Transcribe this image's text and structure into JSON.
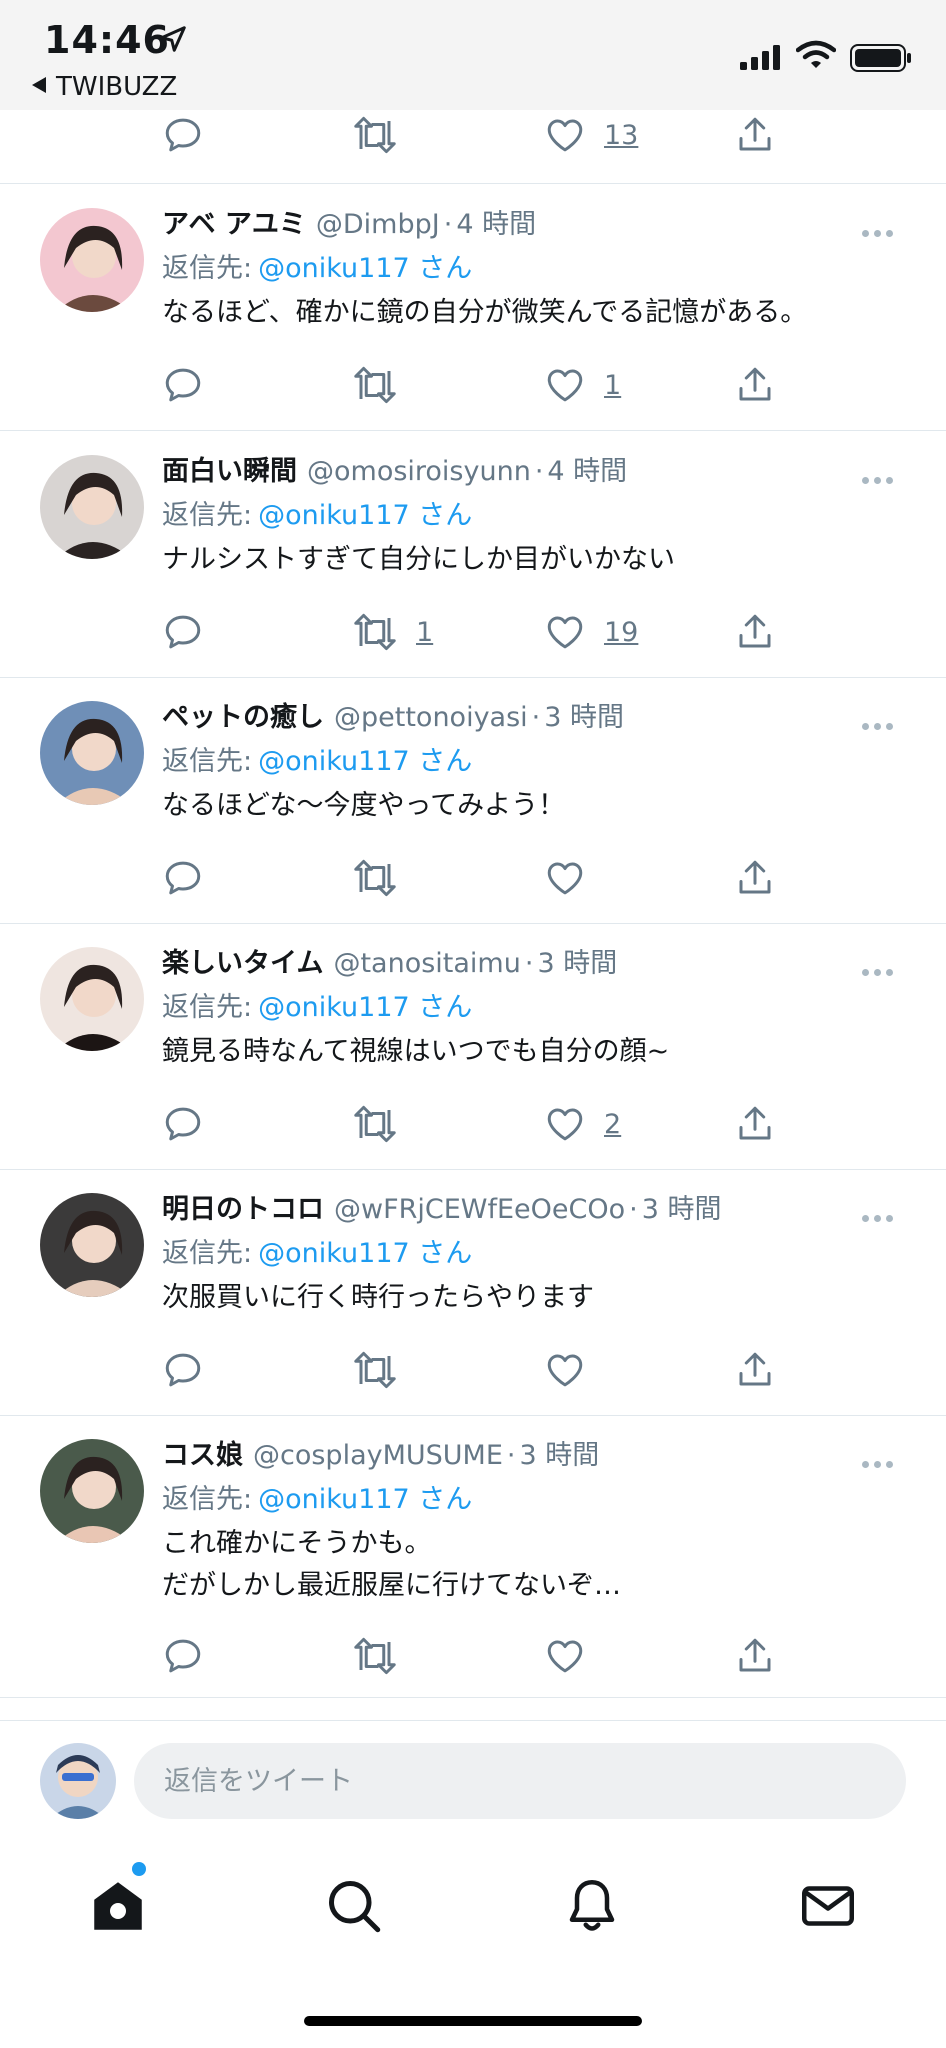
{
  "status_bar": {
    "time": "14:46",
    "back_label": "TWIBUZZ"
  },
  "top_partial": {
    "like_count": "13"
  },
  "reply_prefix": "返信先:",
  "tweets": [
    {
      "name": "アベ アユミ",
      "handle": "@DimbpJ",
      "time": "4 時間",
      "reply_to": "@oniku117 さん",
      "text": "なるほど、確かに鏡の自分が微笑んでる記憶がある。",
      "retweets": "",
      "likes": "1",
      "avatar_colors": [
        "#f3c7d0",
        "#6b4a3e"
      ]
    },
    {
      "name": "面白い瞬間",
      "handle": "@omosiroisyunn",
      "time": "4 時間",
      "reply_to": "@oniku117 さん",
      "text": "ナルシストすぎて自分にしか目がいかない",
      "retweets": "1",
      "likes": "19",
      "avatar_colors": [
        "#d8d4d2",
        "#2a2322"
      ]
    },
    {
      "name": "ペットの癒し",
      "handle": "@pettonoiyasi",
      "time": "3 時間",
      "reply_to": "@oniku117 さん",
      "text": "なるほどな〜今度やってみよう！",
      "retweets": "",
      "likes": "",
      "avatar_colors": [
        "#6f8fb7",
        "#e8c9b5"
      ]
    },
    {
      "name": "楽しいタイム",
      "handle": "@tanositaimu",
      "time": "3 時間",
      "reply_to": "@oniku117 さん",
      "text": "鏡見る時なんて視線はいつでも自分の顔~",
      "retweets": "",
      "likes": "2",
      "avatar_colors": [
        "#efe5e0",
        "#1c1514"
      ]
    },
    {
      "name": "明日のトコロ",
      "handle": "@wFRjCEWfEeOeCOo",
      "time": "3 時間",
      "reply_to": "@oniku117 さん",
      "text": "次服買いに行く時行ったらやります",
      "retweets": "",
      "likes": "",
      "avatar_colors": [
        "#3b3a3a",
        "#e6cdbd"
      ]
    },
    {
      "name": "コス娘",
      "handle": "@cosplayMUSUME",
      "time": "3 時間",
      "reply_to": "@oniku117 さん",
      "text": "これ確かにそうかも。\nだがしかし最近服屋に行けてないぞ…",
      "retweets": "",
      "likes": "",
      "avatar_colors": [
        "#4a5a4b",
        "#e9c6b4"
      ]
    }
  ],
  "reply_bar": {
    "placeholder": "返信をツイート"
  },
  "tab_bar": {
    "items": [
      "home-icon",
      "search-icon",
      "notifications-icon",
      "messages-icon"
    ]
  },
  "colors": {
    "accent": "#1d9bf0",
    "secondary_text": "#657786",
    "divider": "#e1e8ed"
  }
}
